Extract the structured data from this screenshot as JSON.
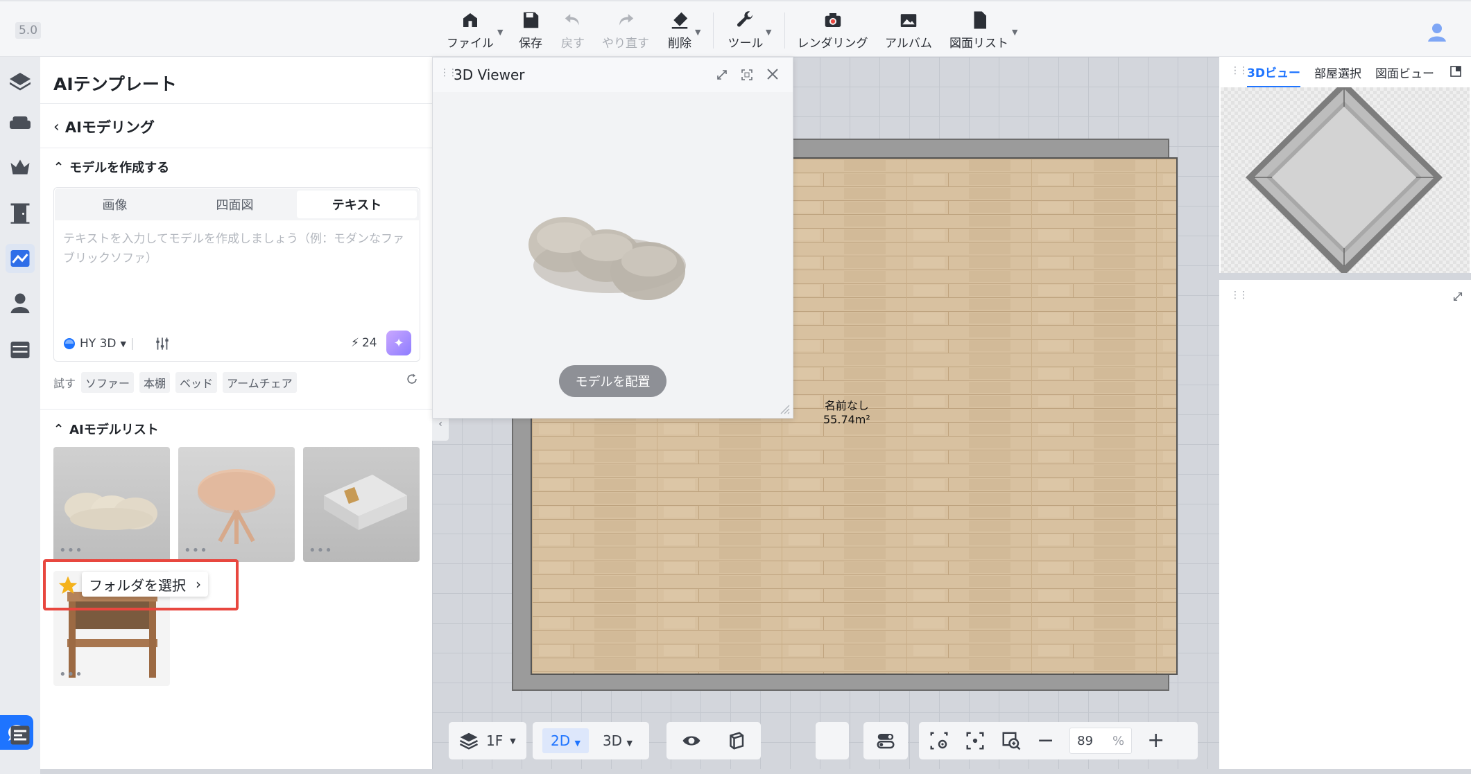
{
  "app": {
    "version": "5.0"
  },
  "toolbar": {
    "file": "ファイル",
    "save": "保存",
    "undo": "戻す",
    "redo": "やり直す",
    "delete": "削除",
    "tools": "ツール",
    "rendering": "レンダリング",
    "album": "アルバム",
    "drawing_list": "図面リスト"
  },
  "panel": {
    "title": "AIテンプレート",
    "back_label": "AIモデリング",
    "create_section": "モデルを作成する",
    "tabs": [
      {
        "label": "画像",
        "active": false
      },
      {
        "label": "四面図",
        "active": false
      },
      {
        "label": "テキスト",
        "active": true
      }
    ],
    "prompt_placeholder": "テキストを入力してモデルを作成しましょう（例：モダンなファブリックソファ）",
    "model_name": "HY 3D",
    "credits": "24",
    "try_label": "試す",
    "try_chips": [
      "ソファー",
      "本棚",
      "ベッド",
      "アームチェア"
    ],
    "list_section": "AIモデルリスト",
    "folder_popup": "フォルダを選択"
  },
  "viewer": {
    "title": "3D Viewer",
    "place_button": "モデルを配置"
  },
  "room": {
    "name": "名前なし",
    "area": "55.74m²"
  },
  "bottom": {
    "floor": "1F",
    "view_2d": "2D",
    "view_3d": "3D",
    "zoom_value": "89",
    "zoom_unit": "%"
  },
  "right_panel": {
    "tabs": [
      {
        "label": "3Dビュー",
        "active": true
      },
      {
        "label": "部屋選択",
        "active": false
      },
      {
        "label": "図面ビュー",
        "active": false
      }
    ]
  },
  "colors": {
    "accent": "#1e74ff",
    "highlight": "#e8473f"
  }
}
